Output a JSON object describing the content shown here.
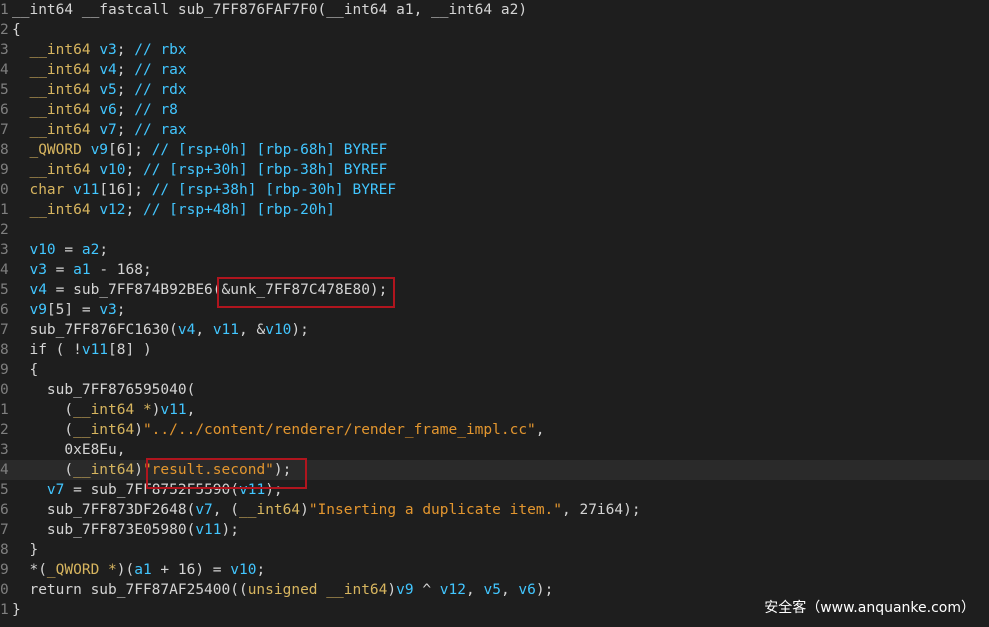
{
  "lines": [
    {
      "ln": "1",
      "tokens": [
        {
          "t": "__int64 __fastcall sub_7FF876FAF7F0(__int64 a1, __int64 a2)",
          "c": "plain"
        }
      ]
    },
    {
      "ln": "2",
      "tokens": [
        {
          "t": "{",
          "c": "plain"
        }
      ]
    },
    {
      "ln": "3",
      "tokens": [
        {
          "t": "  __int64 ",
          "c": "kw"
        },
        {
          "t": "v3",
          "c": "var"
        },
        {
          "t": "; ",
          "c": "plain"
        },
        {
          "t": "// rbx",
          "c": "cm"
        }
      ]
    },
    {
      "ln": "4",
      "tokens": [
        {
          "t": "  __int64 ",
          "c": "kw"
        },
        {
          "t": "v4",
          "c": "var"
        },
        {
          "t": "; ",
          "c": "plain"
        },
        {
          "t": "// rax",
          "c": "cm"
        }
      ]
    },
    {
      "ln": "5",
      "tokens": [
        {
          "t": "  __int64 ",
          "c": "kw"
        },
        {
          "t": "v5",
          "c": "var"
        },
        {
          "t": "; ",
          "c": "plain"
        },
        {
          "t": "// rdx",
          "c": "cm"
        }
      ]
    },
    {
      "ln": "6",
      "tokens": [
        {
          "t": "  __int64 ",
          "c": "kw"
        },
        {
          "t": "v6",
          "c": "var"
        },
        {
          "t": "; ",
          "c": "plain"
        },
        {
          "t": "// r8",
          "c": "cm"
        }
      ]
    },
    {
      "ln": "7",
      "tokens": [
        {
          "t": "  __int64 ",
          "c": "kw"
        },
        {
          "t": "v7",
          "c": "var"
        },
        {
          "t": "; ",
          "c": "plain"
        },
        {
          "t": "// rax",
          "c": "cm"
        }
      ]
    },
    {
      "ln": "8",
      "tokens": [
        {
          "t": "  _QWORD ",
          "c": "kw"
        },
        {
          "t": "v9",
          "c": "var"
        },
        {
          "t": "[6]; ",
          "c": "plain"
        },
        {
          "t": "// [rsp+0h] [rbp-68h] BYREF",
          "c": "cm"
        }
      ]
    },
    {
      "ln": "9",
      "tokens": [
        {
          "t": "  __int64 ",
          "c": "kw"
        },
        {
          "t": "v10",
          "c": "var"
        },
        {
          "t": "; ",
          "c": "plain"
        },
        {
          "t": "// [rsp+30h] [rbp-38h] BYREF",
          "c": "cm"
        }
      ]
    },
    {
      "ln": "0",
      "tokens": [
        {
          "t": "  char ",
          "c": "kw"
        },
        {
          "t": "v11",
          "c": "var"
        },
        {
          "t": "[16]; ",
          "c": "plain"
        },
        {
          "t": "// [rsp+38h] [rbp-30h] BYREF",
          "c": "cm"
        }
      ]
    },
    {
      "ln": "1",
      "tokens": [
        {
          "t": "  __int64 ",
          "c": "kw"
        },
        {
          "t": "v12",
          "c": "var"
        },
        {
          "t": "; ",
          "c": "plain"
        },
        {
          "t": "// [rsp+48h] [rbp-20h]",
          "c": "cm"
        }
      ]
    },
    {
      "ln": "2",
      "tokens": []
    },
    {
      "ln": "3",
      "tokens": [
        {
          "t": "  v10",
          "c": "var"
        },
        {
          "t": " = ",
          "c": "plain"
        },
        {
          "t": "a2",
          "c": "var"
        },
        {
          "t": ";",
          "c": "plain"
        }
      ]
    },
    {
      "ln": "4",
      "tokens": [
        {
          "t": "  v3",
          "c": "var"
        },
        {
          "t": " = ",
          "c": "plain"
        },
        {
          "t": "a1",
          "c": "var"
        },
        {
          "t": " - 168;",
          "c": "plain"
        }
      ]
    },
    {
      "ln": "5",
      "tokens": [
        {
          "t": "  v4",
          "c": "var"
        },
        {
          "t": " = sub_7FF874B92BE6(&unk_7FF87C478E80);",
          "c": "plain"
        }
      ]
    },
    {
      "ln": "6",
      "tokens": [
        {
          "t": "  v9",
          "c": "var"
        },
        {
          "t": "[5] = ",
          "c": "plain"
        },
        {
          "t": "v3",
          "c": "var"
        },
        {
          "t": ";",
          "c": "plain"
        }
      ]
    },
    {
      "ln": "7",
      "tokens": [
        {
          "t": "  sub_7FF876FC1630(",
          "c": "plain"
        },
        {
          "t": "v4",
          "c": "var"
        },
        {
          "t": ", ",
          "c": "plain"
        },
        {
          "t": "v11",
          "c": "var"
        },
        {
          "t": ", &",
          "c": "plain"
        },
        {
          "t": "v10",
          "c": "var"
        },
        {
          "t": ");",
          "c": "plain"
        }
      ]
    },
    {
      "ln": "8",
      "tokens": [
        {
          "t": "  if ( !",
          "c": "plain"
        },
        {
          "t": "v11",
          "c": "var"
        },
        {
          "t": "[8] )",
          "c": "plain"
        }
      ]
    },
    {
      "ln": "9",
      "tokens": [
        {
          "t": "  {",
          "c": "plain"
        }
      ]
    },
    {
      "ln": "0",
      "tokens": [
        {
          "t": "    sub_7FF876595040(",
          "c": "plain"
        }
      ]
    },
    {
      "ln": "1",
      "tokens": [
        {
          "t": "      (",
          "c": "plain"
        },
        {
          "t": "__int64 *",
          "c": "kw"
        },
        {
          "t": ")",
          "c": "plain"
        },
        {
          "t": "v11",
          "c": "var"
        },
        {
          "t": ",",
          "c": "plain"
        }
      ]
    },
    {
      "ln": "2",
      "tokens": [
        {
          "t": "      (",
          "c": "plain"
        },
        {
          "t": "__int64",
          "c": "kw"
        },
        {
          "t": ")",
          "c": "plain"
        },
        {
          "t": "\"../../content/renderer/render_frame_impl.cc\"",
          "c": "str"
        },
        {
          "t": ",",
          "c": "plain"
        }
      ]
    },
    {
      "ln": "3",
      "tokens": [
        {
          "t": "      0xE8Eu,",
          "c": "plain"
        }
      ]
    },
    {
      "ln": "4",
      "hl": true,
      "tokens": [
        {
          "t": "      (",
          "c": "plain"
        },
        {
          "t": "__int64",
          "c": "kw"
        },
        {
          "t": ")",
          "c": "plain"
        },
        {
          "t": "\"result.second\"",
          "c": "str"
        },
        {
          "t": ");",
          "c": "plain"
        }
      ]
    },
    {
      "ln": "5",
      "tokens": [
        {
          "t": "    v7",
          "c": "var"
        },
        {
          "t": " = sub_7FF8752F5590(",
          "c": "plain"
        },
        {
          "t": "v11",
          "c": "var"
        },
        {
          "t": ");",
          "c": "plain"
        }
      ]
    },
    {
      "ln": "6",
      "tokens": [
        {
          "t": "    sub_7FF873DF2648(",
          "c": "plain"
        },
        {
          "t": "v7",
          "c": "var"
        },
        {
          "t": ", (",
          "c": "plain"
        },
        {
          "t": "__int64",
          "c": "kw"
        },
        {
          "t": ")",
          "c": "plain"
        },
        {
          "t": "\"Inserting a duplicate item.\"",
          "c": "str"
        },
        {
          "t": ", 27i64);",
          "c": "plain"
        }
      ]
    },
    {
      "ln": "7",
      "tokens": [
        {
          "t": "    sub_7FF873E05980(",
          "c": "plain"
        },
        {
          "t": "v11",
          "c": "var"
        },
        {
          "t": ");",
          "c": "plain"
        }
      ]
    },
    {
      "ln": "8",
      "tokens": [
        {
          "t": "  }",
          "c": "plain"
        }
      ]
    },
    {
      "ln": "9",
      "tokens": [
        {
          "t": "  *(",
          "c": "plain"
        },
        {
          "t": "_QWORD *",
          "c": "kw"
        },
        {
          "t": ")(",
          "c": "plain"
        },
        {
          "t": "a1",
          "c": "var"
        },
        {
          "t": " + 16) = ",
          "c": "plain"
        },
        {
          "t": "v10",
          "c": "var"
        },
        {
          "t": ";",
          "c": "plain"
        }
      ]
    },
    {
      "ln": "0",
      "tokens": [
        {
          "t": "  return sub_7FF87AF25400((",
          "c": "plain"
        },
        {
          "t": "unsigned __int64",
          "c": "kw"
        },
        {
          "t": ")",
          "c": "plain"
        },
        {
          "t": "v9",
          "c": "var"
        },
        {
          "t": " ^ ",
          "c": "plain"
        },
        {
          "t": "v12",
          "c": "var"
        },
        {
          "t": ", ",
          "c": "plain"
        },
        {
          "t": "v5",
          "c": "var"
        },
        {
          "t": ", ",
          "c": "plain"
        },
        {
          "t": "v6",
          "c": "var"
        },
        {
          "t": ");",
          "c": "plain"
        }
      ]
    },
    {
      "ln": "1",
      "tokens": [
        {
          "t": "}",
          "c": "plain"
        }
      ]
    }
  ],
  "colors": {
    "background": "#1e1e1e",
    "keyword": "#d7b55f",
    "variable": "#42c6ff",
    "string": "#e3962f",
    "text": "#d4d4d4",
    "highlight_box": "#b0151e"
  },
  "watermark": "安全客（www.anquanke.com）"
}
